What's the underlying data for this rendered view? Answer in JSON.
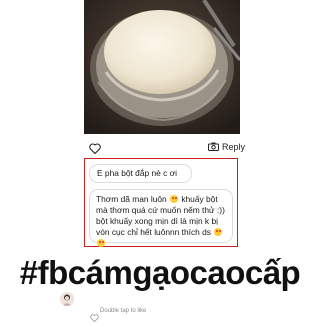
{
  "post": {
    "reply_label": "Reply",
    "icons": {
      "like": "heart-outline-icon",
      "reply": "camera-icon"
    }
  },
  "comments": [
    {
      "text": "E pha bột đắp nè c ơi"
    },
    {
      "text_part1": "Thơm dã man luôn",
      "emoji1": "heart-eyes-emoji",
      "text_part2": "khuấy bột mà thơm quá cứ muốn nếm thử :)) bột khuấy xong mịn dì là mịn k bị vón cục chỉ hết luônnn thích ds",
      "emoji2": "heart-eyes-emoji",
      "emoji3": "heart-eyes-emoji"
    }
  ],
  "hashtag": "#fbcámgạocaocấp",
  "footer": {
    "double_tap_label": "Double tap to like",
    "icon": "heart-outline-icon"
  },
  "colors": {
    "highlight_border": "#c8201f",
    "text": "#111111"
  }
}
